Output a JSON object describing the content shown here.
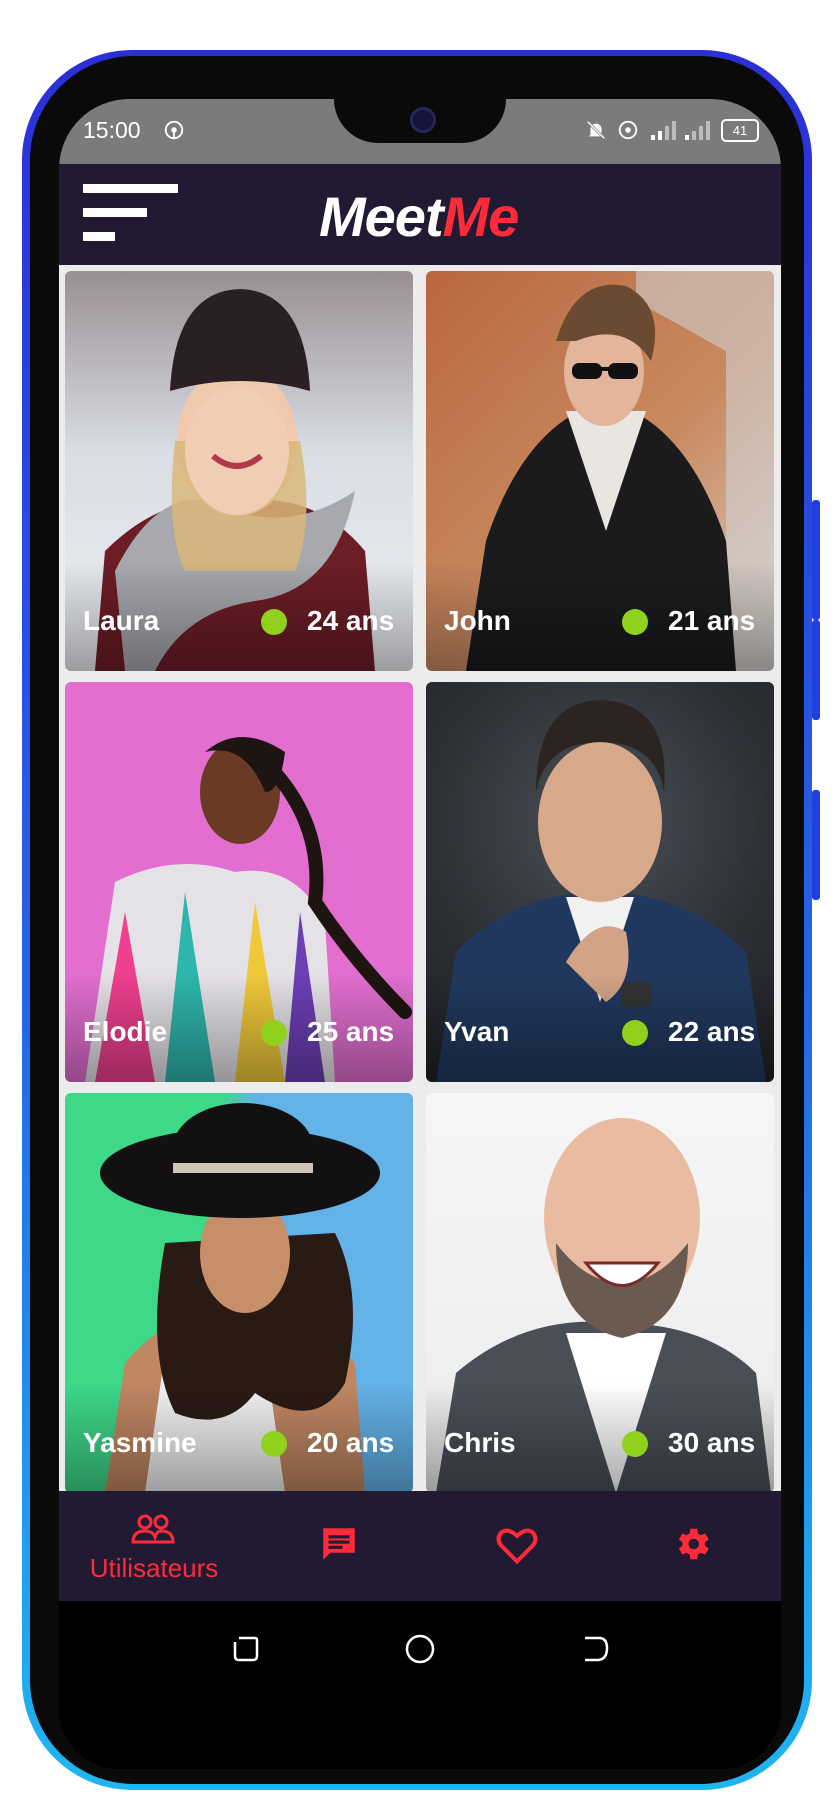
{
  "status_bar": {
    "time": "15:00",
    "battery": "41"
  },
  "app": {
    "logo_part1": "Meet",
    "logo_part2": "Me"
  },
  "colors": {
    "accent": "#ff2b3a",
    "bar_bg": "#221a33",
    "online": "#8fd11d"
  },
  "profiles": [
    {
      "name": "Laura",
      "age": "24 ans",
      "online": true
    },
    {
      "name": "John",
      "age": "21 ans",
      "online": true
    },
    {
      "name": "Elodie",
      "age": "25 ans",
      "online": true
    },
    {
      "name": "Yvan",
      "age": "22 ans",
      "online": true
    },
    {
      "name": "Yasmine",
      "age": "20 ans",
      "online": true
    },
    {
      "name": "Chris",
      "age": "30 ans",
      "online": true
    }
  ],
  "bottom_nav": [
    {
      "icon": "users-icon",
      "label": "Utilisateurs",
      "active": true
    },
    {
      "icon": "chat-icon",
      "label": ""
    },
    {
      "icon": "heart-icon",
      "label": ""
    },
    {
      "icon": "gear-icon",
      "label": ""
    }
  ]
}
